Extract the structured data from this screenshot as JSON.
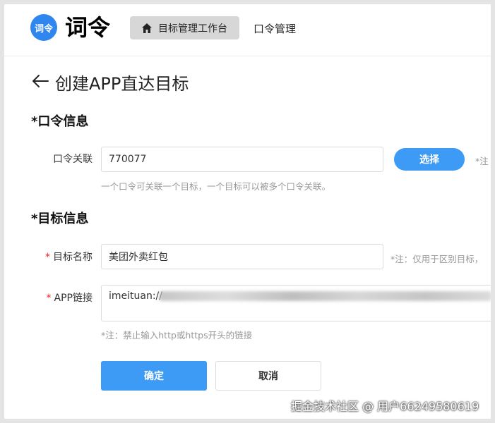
{
  "header": {
    "logo_badge": "词令",
    "logo_text": "词令",
    "nav_active": "目标管理工作台",
    "nav_item": "口令管理"
  },
  "page": {
    "title": "创建APP直达目标"
  },
  "kouling": {
    "section_title": "*口令信息",
    "label": "口令关联",
    "value": "770077",
    "select_button": "选择",
    "side_note": "*注",
    "hint": "一个口令可关联一个目标，一个目标可以被多个口令关联。"
  },
  "target": {
    "section_title": "*目标信息",
    "name_label": "目标名称",
    "name_value": "美团外卖红包",
    "name_note": "*注：仅用于区别目标，",
    "link_label": "APP链接",
    "link_value": "imeituan://",
    "link_hint": "*注：禁止输入http或https开头的链接",
    "required_mark": "*"
  },
  "actions": {
    "confirm": "确定",
    "cancel": "取消"
  },
  "watermark": "掘金技术社区 @ 用户66249580619",
  "colors": {
    "accent": "#3d9bf5",
    "logo": "#2f86ee",
    "required": "#f5222d"
  }
}
